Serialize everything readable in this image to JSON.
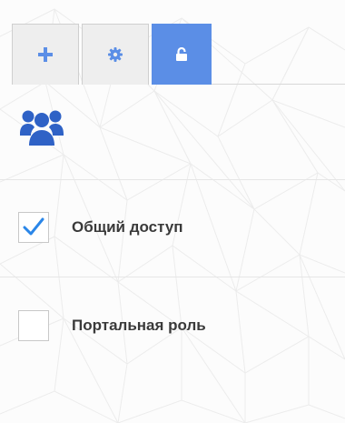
{
  "toolbar": {
    "tabs": [
      {
        "icon": "plus-icon"
      },
      {
        "icon": "gear-icon"
      },
      {
        "icon": "unlock-icon",
        "active": true
      }
    ]
  },
  "section": {
    "icon": "users-group-icon"
  },
  "options": [
    {
      "label": "Общий доступ",
      "checked": true
    },
    {
      "label": "Портальная роль",
      "checked": false
    }
  ],
  "colors": {
    "accent": "#5b8ee6",
    "icon_blue": "#2f62c6",
    "checkmark": "#2a86e8",
    "tab_bg": "#eeeeee",
    "text": "#3a3a3a"
  }
}
